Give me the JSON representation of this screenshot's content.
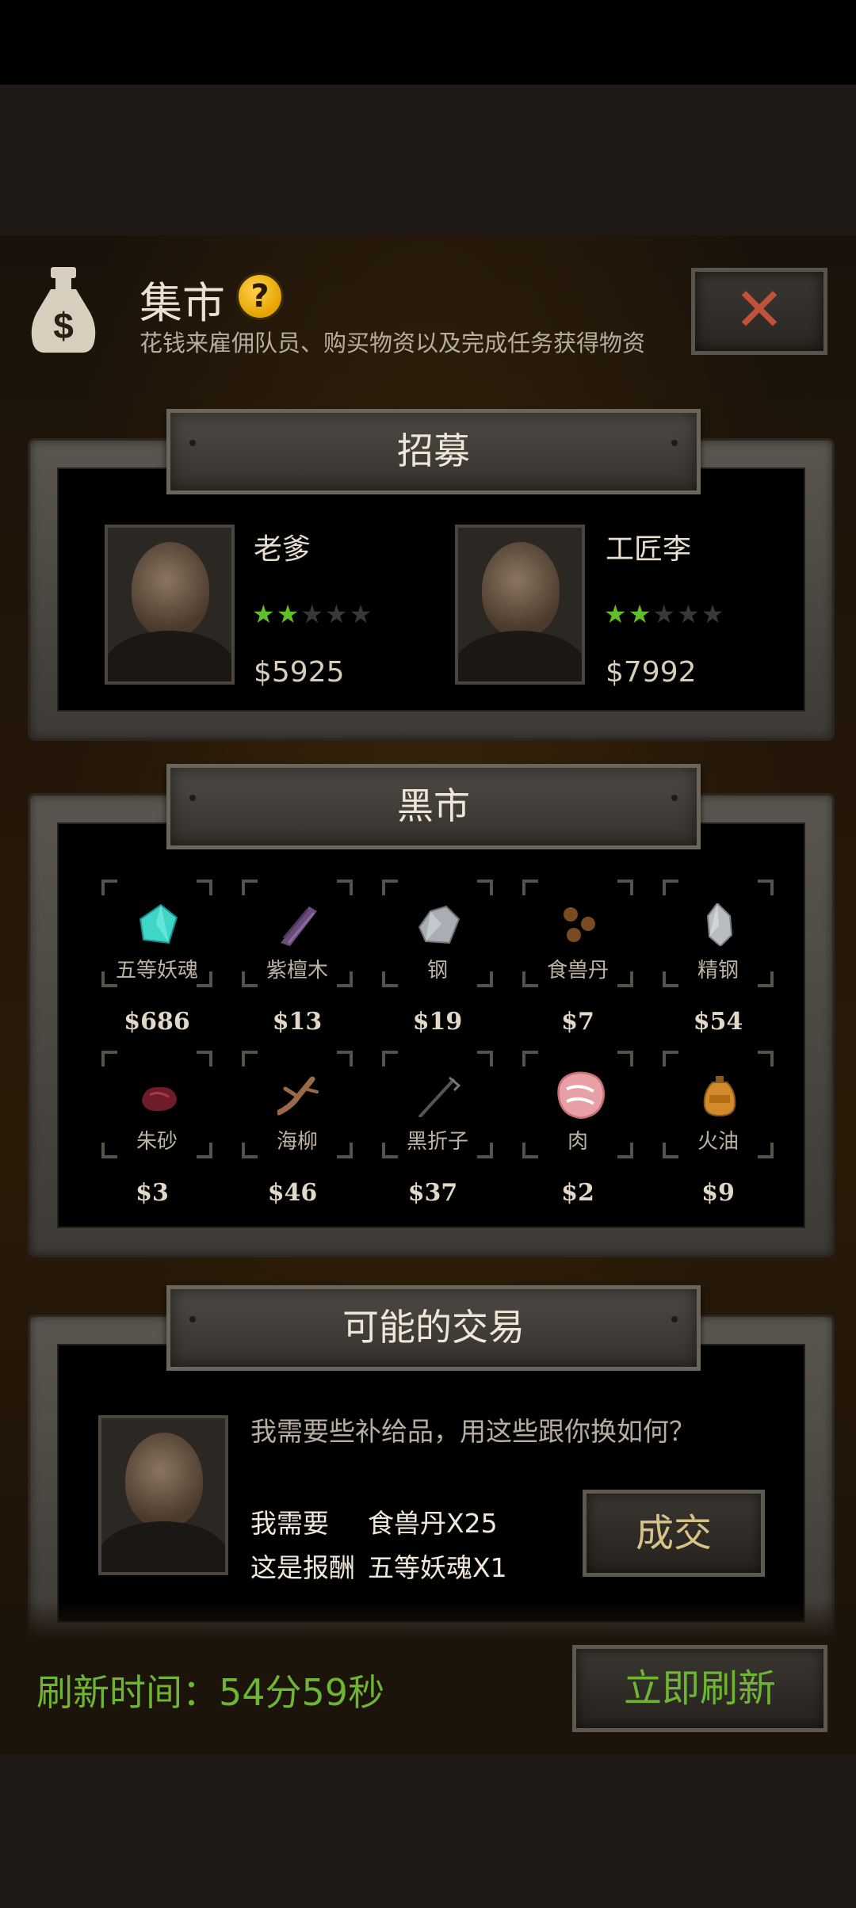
{
  "header": {
    "title": "集市",
    "help_icon": "?",
    "subtitle": "花钱来雇佣队员、购买物资以及完成任务获得物资",
    "close_icon": "✕"
  },
  "recruit": {
    "title": "招募",
    "items": [
      {
        "name": "老爹",
        "stars": 2,
        "max_stars": 5,
        "price": "$5925"
      },
      {
        "name": "工匠李",
        "stars": 2,
        "max_stars": 5,
        "price": "$7992"
      }
    ]
  },
  "market": {
    "title": "黑市",
    "items": [
      {
        "name": "五等妖魂",
        "price": "$686",
        "icon": "crystal-icon",
        "color": "#3fd6c8"
      },
      {
        "name": "紫檀木",
        "price": "$13",
        "icon": "wood-icon",
        "color": "#6a4c7a"
      },
      {
        "name": "钢",
        "price": "$19",
        "icon": "steel-ore-icon",
        "color": "#a9aeb5"
      },
      {
        "name": "食兽丹",
        "price": "$7",
        "icon": "pills-icon",
        "color": "#7a4a22"
      },
      {
        "name": "精钢",
        "price": "$54",
        "icon": "refined-steel-icon",
        "color": "#b9bcc0"
      },
      {
        "name": "朱砂",
        "price": "$3",
        "icon": "cinnabar-icon",
        "color": "#6e1d28"
      },
      {
        "name": "海柳",
        "price": "$46",
        "icon": "branch-icon",
        "color": "#9a6a48"
      },
      {
        "name": "黑折子",
        "price": "$37",
        "icon": "fire-stick-icon",
        "color": "#444444"
      },
      {
        "name": "肉",
        "price": "$2",
        "icon": "meat-icon",
        "color": "#e8a0a6"
      },
      {
        "name": "火油",
        "price": "$9",
        "icon": "oil-jar-icon",
        "color": "#d28a2a"
      }
    ]
  },
  "trade": {
    "title": "可能的交易",
    "message": "我需要些补给品，用这些跟你换如何？",
    "need_label": "我需要",
    "need_value": "食兽丹X25",
    "reward_label": "这是报酬",
    "reward_value": "五等妖魂X1",
    "deal_button": "成交"
  },
  "footer": {
    "refresh_time": "刷新时间：54分59秒",
    "refresh_button": "立即刷新"
  }
}
